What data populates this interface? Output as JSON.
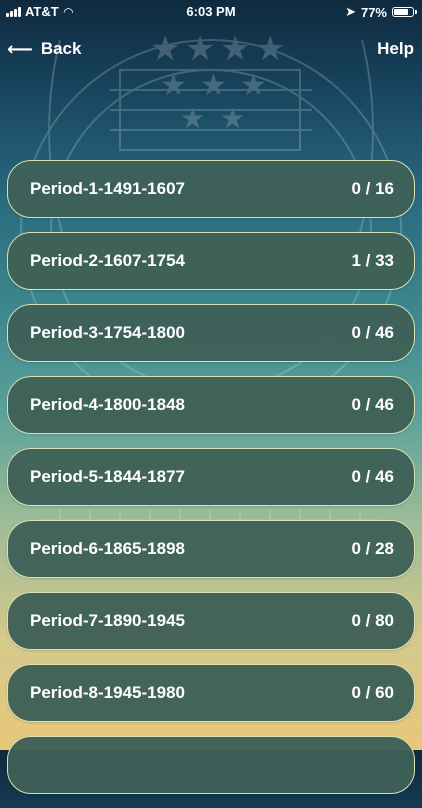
{
  "status_bar": {
    "carrier": "AT&T",
    "time": "6:03 PM",
    "battery": "77%"
  },
  "nav": {
    "back_label": "Back",
    "help_label": "Help"
  },
  "periods": [
    {
      "title": "Period-1-1491-1607",
      "count": "0 / 16"
    },
    {
      "title": "Period-2-1607-1754",
      "count": "1 / 33"
    },
    {
      "title": "Period-3-1754-1800",
      "count": "0 / 46"
    },
    {
      "title": "Period-4-1800-1848",
      "count": "0 / 46"
    },
    {
      "title": "Period-5-1844-1877",
      "count": "0 / 46"
    },
    {
      "title": "Period-6-1865-1898",
      "count": "0 / 28"
    },
    {
      "title": "Period-7-1890-1945",
      "count": "0 / 80"
    },
    {
      "title": "Period-8-1945-1980",
      "count": "0 / 60"
    },
    {
      "title": "",
      "count": ""
    }
  ]
}
